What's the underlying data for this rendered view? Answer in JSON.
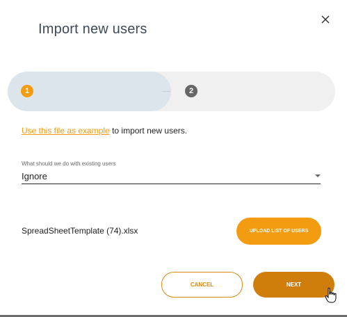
{
  "dialog": {
    "title": "Import new users",
    "close_icon": "close-icon"
  },
  "stepper": {
    "steps": [
      {
        "number": "1",
        "state": "active"
      },
      {
        "number": "2",
        "state": "inactive"
      }
    ]
  },
  "example": {
    "link_text": "Use this file as example",
    "suffix_text": " to import new users."
  },
  "existing_users": {
    "label": "What should we do with existing users",
    "value": "Ignore"
  },
  "file": {
    "name": "SpreadSheetTemplate (74).xlsx",
    "upload_label": "UPLOAD LIST OF USERS"
  },
  "actions": {
    "cancel_label": "CANCEL",
    "next_label": "NEXT"
  },
  "colors": {
    "accent": "#f39c12",
    "accent_dark": "#cf7e0c",
    "step_active_bg": "#dce5eb",
    "step_inactive_bg": "#f0f0f0"
  }
}
